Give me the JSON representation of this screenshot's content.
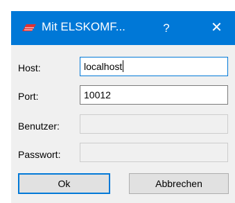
{
  "window": {
    "title": "Mit ELSKOMF...",
    "help_label": "?",
    "close_label": "✕",
    "accent_color": "#0078d7",
    "icon": "elskomf-app-icon"
  },
  "form": {
    "host": {
      "label": "Host:",
      "value": "localhost"
    },
    "port": {
      "label": "Port:",
      "value": "10012"
    },
    "user": {
      "label": "Benutzer:",
      "value": ""
    },
    "password": {
      "label": "Passwort:",
      "value": ""
    }
  },
  "buttons": {
    "ok_label": "Ok",
    "cancel_label": "Abbrechen"
  }
}
